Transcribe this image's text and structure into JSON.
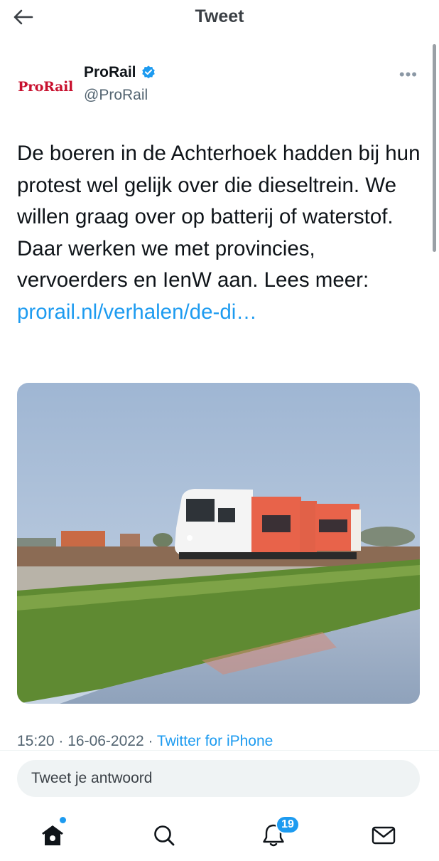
{
  "header": {
    "title": "Tweet",
    "back_icon": "arrow-left-icon"
  },
  "author": {
    "avatar_logo": "ProRail",
    "name": "ProRail",
    "handle": "@ProRail",
    "verified_icon": "verified-badge-icon",
    "more_icon": "more-horizontal-icon"
  },
  "tweet": {
    "text": "De boeren in de Achterhoek hadden bij hun protest wel gelijk over die dieseltrein. We willen graag over op batterij of waterstof. Daar werken we met provincies, vervoerders en IenW aan. Lees meer: ",
    "link_text": "prorail.nl/verhalen/de-di…"
  },
  "meta": {
    "timestamp": "15:20 · 16-06-2022 · ",
    "source": "Twitter for iPhone"
  },
  "reply": {
    "placeholder": "Tweet je antwoord"
  },
  "nav": {
    "items": [
      {
        "icon": "home-icon"
      },
      {
        "icon": "search-icon"
      },
      {
        "icon": "notifications-icon",
        "badge": "19"
      },
      {
        "icon": "messages-icon"
      }
    ]
  },
  "colors": {
    "accent": "#1d9bf0",
    "brand_red": "#c8102e",
    "text": "#0f1419",
    "secondary_text": "#536471",
    "reply_bg": "#eff3f4"
  }
}
